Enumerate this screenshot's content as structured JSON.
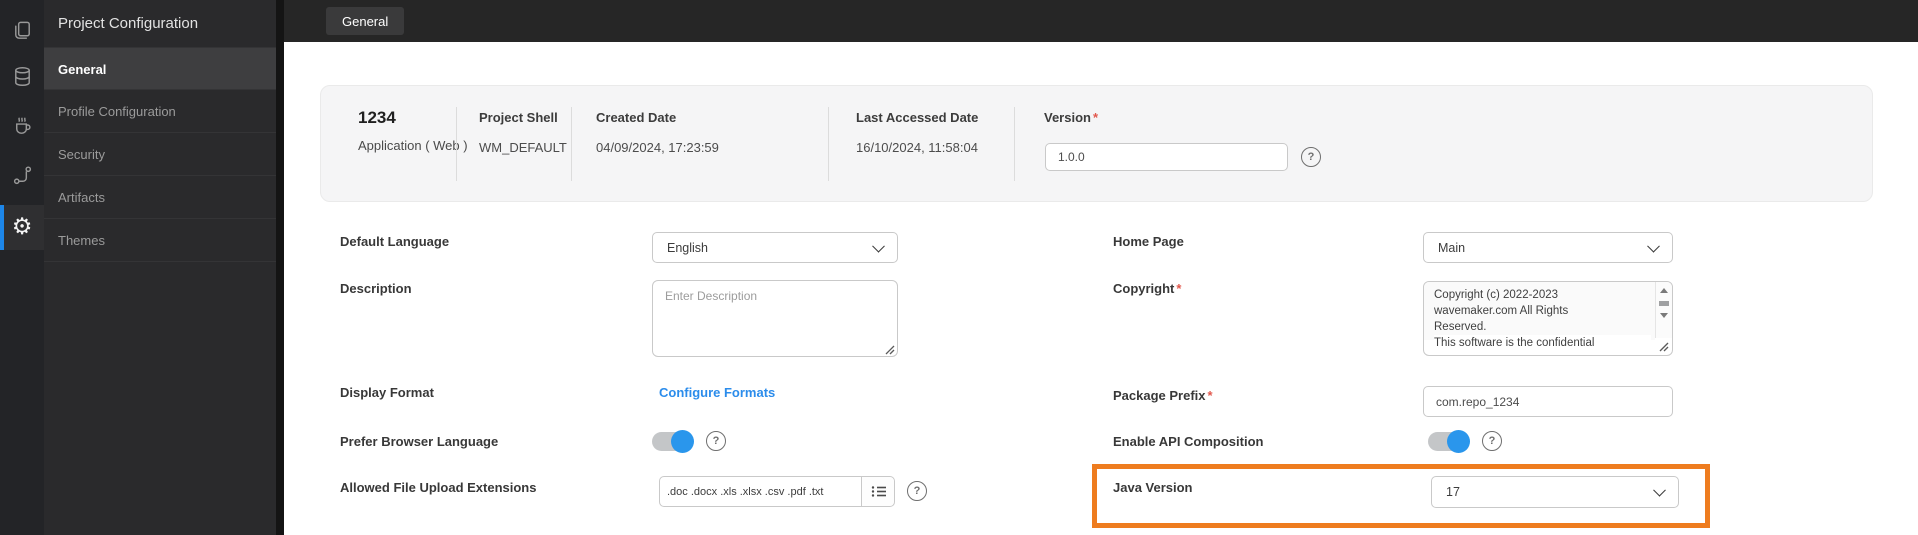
{
  "colors": {
    "accent_blue": "#2a96ec",
    "link_blue": "#2b8ceb",
    "highlight_orange": "#ee7c1f",
    "sidebar_dark": "#2a2a2c",
    "rail_dark": "#232427",
    "required_red": "#e2574c"
  },
  "rail": {
    "icons": [
      "pages-icon",
      "database-icon",
      "java-services-icon",
      "apis-icon",
      "settings-gear-icon"
    ],
    "active_icon": "settings-gear-icon"
  },
  "sidebar": {
    "title": "Project Configuration",
    "items": [
      {
        "label": "General",
        "active": true
      },
      {
        "label": "Profile Configuration",
        "active": false
      },
      {
        "label": "Security",
        "active": false
      },
      {
        "label": "Artifacts",
        "active": false
      },
      {
        "label": "Themes",
        "active": false
      }
    ]
  },
  "topbar": {
    "tabs": [
      {
        "label": "General",
        "active": true
      }
    ]
  },
  "info_card": {
    "project_name": "1234",
    "project_type": "Application ( Web )",
    "fields": [
      {
        "label": "Project Shell",
        "value": "WM_DEFAULT"
      },
      {
        "label": "Created Date",
        "value": "04/09/2024, 17:23:59"
      },
      {
        "label": "Last Accessed Date",
        "value": "16/10/2024, 11:58:04"
      }
    ],
    "version": {
      "label": "Version",
      "required": "*",
      "value": "1.0.0"
    }
  },
  "form": {
    "left": {
      "default_language": {
        "label": "Default Language",
        "value": "English"
      },
      "description": {
        "label": "Description",
        "placeholder": "Enter Description"
      },
      "display_format": {
        "label": "Display Format",
        "link": "Configure Formats"
      },
      "prefer_browser_language": {
        "label": "Prefer Browser Language",
        "enabled": true
      },
      "allowed_file_upload_extensions": {
        "label": "Allowed File Upload Extensions",
        "value": ".doc .docx .xls .xlsx .csv .pdf .txt"
      }
    },
    "right": {
      "home_page": {
        "label": "Home Page",
        "value": "Main"
      },
      "copyright": {
        "label": "Copyright",
        "required": "*",
        "lines": [
          "Copyright (c) 2022-2023",
          "wavemaker.com All Rights",
          "Reserved.",
          "This software is the confidential"
        ]
      },
      "package_prefix": {
        "label": "Package Prefix",
        "required": "*",
        "value": "com.repo_1234"
      },
      "enable_api_composition": {
        "label": "Enable API Composition",
        "enabled": true
      },
      "java_version": {
        "label": "Java Version",
        "value": "17",
        "highlighted": true
      }
    }
  }
}
